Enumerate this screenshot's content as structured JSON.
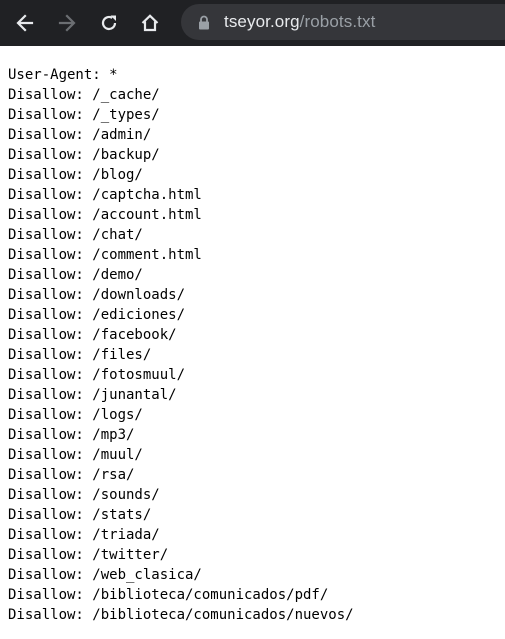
{
  "browser": {
    "url_domain": "tseyor.org",
    "url_path": "/robots.txt",
    "icons": {
      "back": "arrow-left-icon",
      "forward": "arrow-right-icon",
      "reload": "reload-icon",
      "home": "home-icon",
      "lock": "lock-icon"
    },
    "colors": {
      "toolbar": "#202124",
      "omnibox": "#35363a",
      "text_bright": "#e8eaed",
      "text_dim": "#9aa0a6"
    }
  },
  "robots": {
    "lines": [
      "User-Agent: *",
      "Disallow: /_cache/",
      "Disallow: /_types/",
      "Disallow: /admin/",
      "Disallow: /backup/",
      "Disallow: /blog/",
      "Disallow: /captcha.html",
      "Disallow: /account.html",
      "Disallow: /chat/",
      "Disallow: /comment.html",
      "Disallow: /demo/",
      "Disallow: /downloads/",
      "Disallow: /ediciones/",
      "Disallow: /facebook/",
      "Disallow: /files/",
      "Disallow: /fotosmuul/",
      "Disallow: /junantal/",
      "Disallow: /logs/",
      "Disallow: /mp3/",
      "Disallow: /muul/",
      "Disallow: /rsa/",
      "Disallow: /sounds/",
      "Disallow: /stats/",
      "Disallow: /triada/",
      "Disallow: /twitter/",
      "Disallow: /web_clasica/",
      "Disallow: /biblioteca/comunicados/pdf/",
      "Disallow: /biblioteca/comunicados/nuevos/"
    ]
  }
}
